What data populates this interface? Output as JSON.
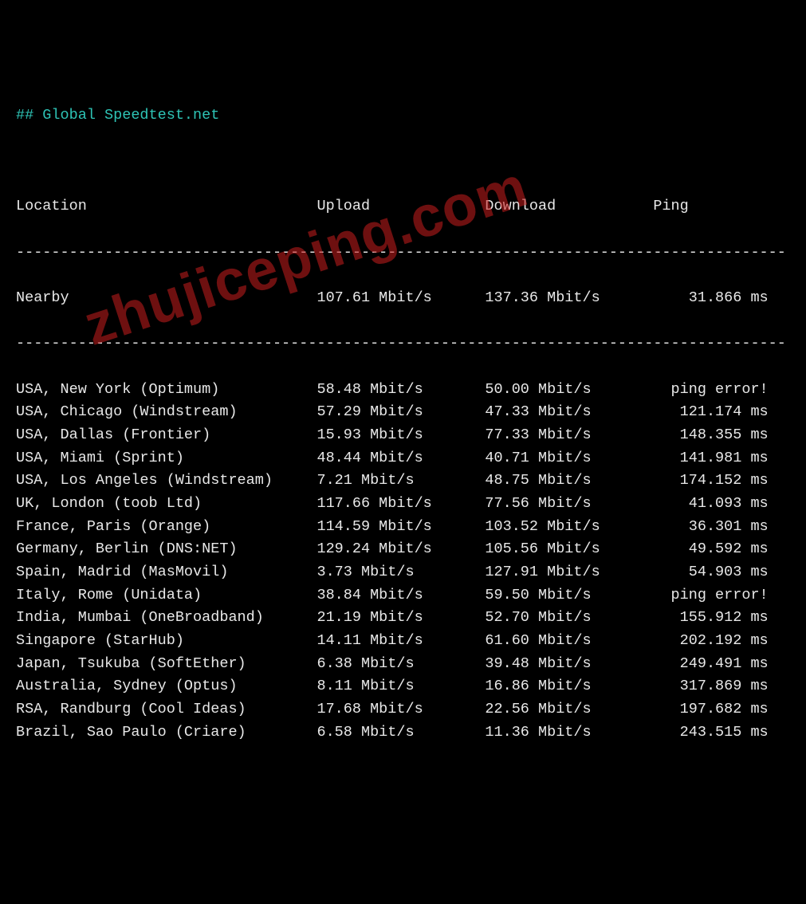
{
  "title": "## Global Speedtest.net",
  "headers": {
    "location": "Location",
    "upload": "Upload",
    "download": "Download",
    "ping": "Ping"
  },
  "nearby": {
    "label": "Nearby",
    "upload": "107.61 Mbit/s",
    "download": "137.36 Mbit/s",
    "ping": "31.866 ms"
  },
  "rows": [
    {
      "location": "USA, New York (Optimum)",
      "upload": "58.48 Mbit/s",
      "download": "50.00 Mbit/s",
      "ping": "ping error!"
    },
    {
      "location": "USA, Chicago (Windstream)",
      "upload": "57.29 Mbit/s",
      "download": "47.33 Mbit/s",
      "ping": "121.174 ms"
    },
    {
      "location": "USA, Dallas (Frontier)",
      "upload": "15.93 Mbit/s",
      "download": "77.33 Mbit/s",
      "ping": "148.355 ms"
    },
    {
      "location": "USA, Miami (Sprint)",
      "upload": "48.44 Mbit/s",
      "download": "40.71 Mbit/s",
      "ping": "141.981 ms"
    },
    {
      "location": "USA, Los Angeles (Windstream)",
      "upload": "7.21 Mbit/s",
      "download": "48.75 Mbit/s",
      "ping": "174.152 ms"
    },
    {
      "location": "UK, London (toob Ltd)",
      "upload": "117.66 Mbit/s",
      "download": "77.56 Mbit/s",
      "ping": "41.093 ms"
    },
    {
      "location": "France, Paris (Orange)",
      "upload": "114.59 Mbit/s",
      "download": "103.52 Mbit/s",
      "ping": "36.301 ms"
    },
    {
      "location": "Germany, Berlin (DNS:NET)",
      "upload": "129.24 Mbit/s",
      "download": "105.56 Mbit/s",
      "ping": "49.592 ms"
    },
    {
      "location": "Spain, Madrid (MasMovil)",
      "upload": "3.73 Mbit/s",
      "download": "127.91 Mbit/s",
      "ping": "54.903 ms"
    },
    {
      "location": "Italy, Rome (Unidata)",
      "upload": "38.84 Mbit/s",
      "download": "59.50 Mbit/s",
      "ping": "ping error!"
    },
    {
      "location": "India, Mumbai (OneBroadband)",
      "upload": "21.19 Mbit/s",
      "download": "52.70 Mbit/s",
      "ping": "155.912 ms"
    },
    {
      "location": "Singapore (StarHub)",
      "upload": "14.11 Mbit/s",
      "download": "61.60 Mbit/s",
      "ping": "202.192 ms"
    },
    {
      "location": "Japan, Tsukuba (SoftEther)",
      "upload": "6.38 Mbit/s",
      "download": "39.48 Mbit/s",
      "ping": "249.491 ms"
    },
    {
      "location": "Australia, Sydney (Optus)",
      "upload": "8.11 Mbit/s",
      "download": "16.86 Mbit/s",
      "ping": "317.869 ms"
    },
    {
      "location": "RSA, Randburg (Cool Ideas)",
      "upload": "17.68 Mbit/s",
      "download": "22.56 Mbit/s",
      "ping": "197.682 ms"
    },
    {
      "location": "Brazil, Sao Paulo (Criare)",
      "upload": "6.58 Mbit/s",
      "download": "11.36 Mbit/s",
      "ping": "243.515 ms"
    }
  ],
  "watermark": "zhujiceping.com",
  "chart_data": {
    "type": "table",
    "title": "Global Speedtest.net",
    "columns": [
      "Location",
      "Upload",
      "Download",
      "Ping"
    ],
    "rows": [
      [
        "Nearby",
        "107.61 Mbit/s",
        "137.36 Mbit/s",
        "31.866 ms"
      ],
      [
        "USA, New York (Optimum)",
        "58.48 Mbit/s",
        "50.00 Mbit/s",
        "ping error!"
      ],
      [
        "USA, Chicago (Windstream)",
        "57.29 Mbit/s",
        "47.33 Mbit/s",
        "121.174 ms"
      ],
      [
        "USA, Dallas (Frontier)",
        "15.93 Mbit/s",
        "77.33 Mbit/s",
        "148.355 ms"
      ],
      [
        "USA, Miami (Sprint)",
        "48.44 Mbit/s",
        "40.71 Mbit/s",
        "141.981 ms"
      ],
      [
        "USA, Los Angeles (Windstream)",
        "7.21 Mbit/s",
        "48.75 Mbit/s",
        "174.152 ms"
      ],
      [
        "UK, London (toob Ltd)",
        "117.66 Mbit/s",
        "77.56 Mbit/s",
        "41.093 ms"
      ],
      [
        "France, Paris (Orange)",
        "114.59 Mbit/s",
        "103.52 Mbit/s",
        "36.301 ms"
      ],
      [
        "Germany, Berlin (DNS:NET)",
        "129.24 Mbit/s",
        "105.56 Mbit/s",
        "49.592 ms"
      ],
      [
        "Spain, Madrid (MasMovil)",
        "3.73 Mbit/s",
        "127.91 Mbit/s",
        "54.903 ms"
      ],
      [
        "Italy, Rome (Unidata)",
        "38.84 Mbit/s",
        "59.50 Mbit/s",
        "ping error!"
      ],
      [
        "India, Mumbai (OneBroadband)",
        "21.19 Mbit/s",
        "52.70 Mbit/s",
        "155.912 ms"
      ],
      [
        "Singapore (StarHub)",
        "14.11 Mbit/s",
        "61.60 Mbit/s",
        "202.192 ms"
      ],
      [
        "Japan, Tsukuba (SoftEther)",
        "6.38 Mbit/s",
        "39.48 Mbit/s",
        "249.491 ms"
      ],
      [
        "Australia, Sydney (Optus)",
        "8.11 Mbit/s",
        "16.86 Mbit/s",
        "317.869 ms"
      ],
      [
        "RSA, Randburg (Cool Ideas)",
        "17.68 Mbit/s",
        "22.56 Mbit/s",
        "197.682 ms"
      ],
      [
        "Brazil, Sao Paulo (Criare)",
        "6.58 Mbit/s",
        "11.36 Mbit/s",
        "243.515 ms"
      ]
    ]
  }
}
